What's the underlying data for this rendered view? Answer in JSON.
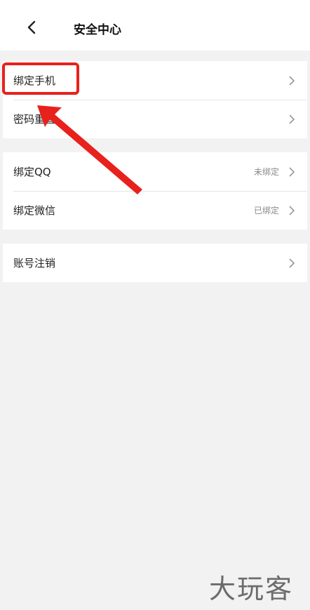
{
  "header": {
    "title": "安全中心",
    "back_icon": "chevron-left-icon"
  },
  "groups": [
    {
      "rows": [
        {
          "label": "绑定手机",
          "status": ""
        },
        {
          "label": "密码重置",
          "status": ""
        }
      ]
    },
    {
      "rows": [
        {
          "label": "绑定QQ",
          "status": "未绑定"
        },
        {
          "label": "绑定微信",
          "status": "已绑定"
        }
      ]
    },
    {
      "rows": [
        {
          "label": "账号注销",
          "status": ""
        }
      ]
    }
  ],
  "annotation": {
    "highlight_color": "#e8211d"
  },
  "watermark": {
    "text": "大玩客"
  }
}
